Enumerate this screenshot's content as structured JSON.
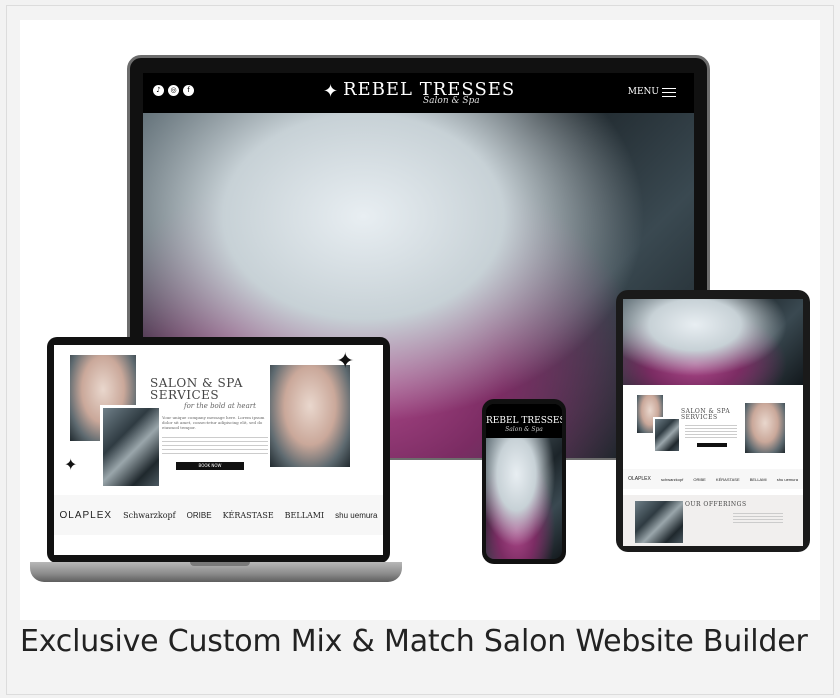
{
  "caption": "Exclusive Custom Mix & Match Salon Website Builder",
  "desktop": {
    "logo_main": "REBEL TRESSES",
    "logo_script": "Salon & Spa",
    "menu_label": "MENU",
    "social_icons": [
      "tiktok-icon",
      "instagram-icon",
      "facebook-icon"
    ]
  },
  "laptop": {
    "services_title_line1": "SALON & SPA",
    "services_title_line2": "SERVICES",
    "services_script": "for the bold at heart",
    "intro_text": "Your unique company message here. Lorem ipsum dolor sit amet, consectetur adipiscing elit, sed do eiusmod tempor.",
    "button_label": "BOOK NOW",
    "brands": [
      "OLAPLEX",
      "Schwarzkopf",
      "ORIBE",
      "KÉRASTASE",
      "BELLAMI",
      "shu uemura"
    ]
  },
  "tablet": {
    "services_title_line1": "SALON & SPA",
    "services_title_line2": "SERVICES",
    "brands": [
      "OLAPLEX",
      "schwarzkopf",
      "ORIBE",
      "KÉRASTASE",
      "BELLAMI",
      "shu uemura"
    ],
    "offerings_title": "OUR OFFERINGS"
  },
  "phone": {
    "logo_main": "REBEL TRESSES",
    "logo_script": "Salon & Spa"
  },
  "colors": {
    "background": "#f3f3f3",
    "frame": "#111111",
    "caption_text": "#222222"
  }
}
